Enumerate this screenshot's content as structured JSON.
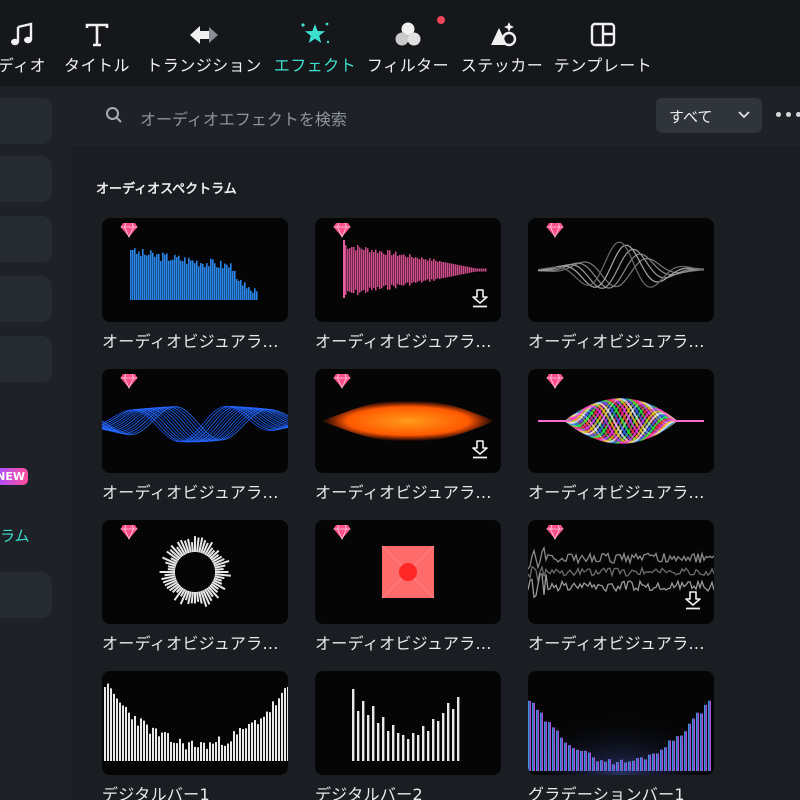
{
  "toolbar": {
    "items": [
      {
        "label": "ディオ",
        "icon": "music-note-icon",
        "active": false
      },
      {
        "label": "タイトル",
        "icon": "text-t-icon",
        "active": false
      },
      {
        "label": "トランジション",
        "icon": "transition-arrows-icon",
        "active": false
      },
      {
        "label": "エフェクト",
        "icon": "effects-star-icon",
        "active": true
      },
      {
        "label": "フィルター",
        "icon": "filter-circles-icon",
        "active": false,
        "notification": true
      },
      {
        "label": "ステッカー",
        "icon": "sticker-icon",
        "active": false
      },
      {
        "label": "テンプレート",
        "icon": "template-layout-icon",
        "active": false
      }
    ],
    "accent_color": "#3de0cf",
    "notification_color": "#f0465a"
  },
  "sidebar": {
    "new_badge": "NEW",
    "active_item": "ラム"
  },
  "search": {
    "placeholder": "オーディオエフェクトを検索",
    "filter_value": "すべて"
  },
  "section": {
    "title": "オーディオスペクトラム",
    "items": [
      {
        "caption": "オーディオビジュアラ...",
        "premium": true,
        "download": false,
        "style": "blue-spectrum-bars"
      },
      {
        "caption": "オーディオビジュアラ...",
        "premium": true,
        "download": true,
        "style": "pink-waveform"
      },
      {
        "caption": "オーディオビジュアラ...",
        "premium": true,
        "download": false,
        "style": "grey-sine-lines"
      },
      {
        "caption": "オーディオビジュアラ...",
        "premium": true,
        "download": false,
        "style": "blue-helix-wave"
      },
      {
        "caption": "オーディオビジュアラ...",
        "premium": true,
        "download": true,
        "style": "orange-glow-wave"
      },
      {
        "caption": "オーディオビジュアラ...",
        "premium": true,
        "download": false,
        "style": "rgb-interference-wave"
      },
      {
        "caption": "オーディオビジュアラ...",
        "premium": true,
        "download": false,
        "style": "radial-circle-bars"
      },
      {
        "caption": "オーディオビジュアラ...",
        "premium": true,
        "download": false,
        "style": "red-square-circle"
      },
      {
        "caption": "オーディオビジュアラ...",
        "premium": true,
        "download": true,
        "style": "grey-noise-waveform"
      },
      {
        "caption": "デジタルバー1",
        "premium": false,
        "download": false,
        "style": "white-bars-valley"
      },
      {
        "caption": "デジタルバー2",
        "premium": false,
        "download": false,
        "style": "white-bars-peaks"
      },
      {
        "caption": "グラデーションバー1",
        "premium": false,
        "download": false,
        "style": "gradient-bars"
      }
    ]
  }
}
